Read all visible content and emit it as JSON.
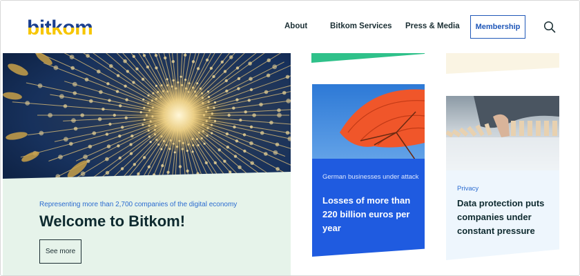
{
  "brand": {
    "logo_text": "bitkom",
    "accent_blue": "#1f57b8",
    "logo_yellow": "#f7c600"
  },
  "nav": {
    "items": [
      {
        "label": "About"
      },
      {
        "label": "Bitkom Services"
      },
      {
        "label": "Press & Media"
      }
    ],
    "membership_label": "Membership",
    "search_icon": "magnifier-icon"
  },
  "hero": {
    "kicker": "Representing more than 2,700 companies of the digital economy",
    "title": "Welcome to Bitkom!",
    "button_label": "See more",
    "panel_color": "#e6f3ea"
  },
  "cards": [
    {
      "kicker": "German businesses under attack",
      "title": "Losses of more than 220 billion euros per year",
      "panel_color": "#1f5be0"
    },
    {
      "kicker": "Privacy",
      "title": "Data protection puts companies under constant pressure",
      "panel_color": "#eef6fd"
    }
  ]
}
